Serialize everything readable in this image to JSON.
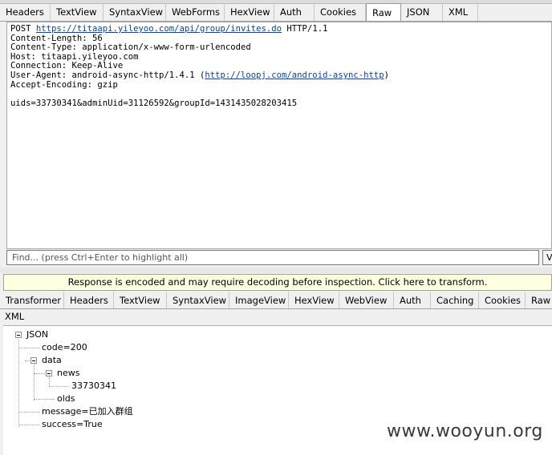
{
  "request_tabs": [
    "Headers",
    "TextView",
    "SyntaxView",
    "WebForms",
    "HexView",
    "Auth",
    "Cookies",
    "Raw",
    "JSON",
    "XML"
  ],
  "request_selected_tab": "Raw",
  "raw": {
    "line1_method": "POST ",
    "line1_url": "https://titaapi.yileyoo.com/api/group/invites.do",
    "line1_proto": " HTTP/1.1",
    "content_length": "Content-Length: 56",
    "content_type": "Content-Type: application/x-www-form-urlencoded",
    "host": "Host: titaapi.yileyoo.com",
    "connection": "Connection: Keep-Alive",
    "ua_prefix": "User-Agent: android-async-http/1.4.1 (",
    "ua_link": "http://loopj.com/android-async-http",
    "ua_suffix": ")",
    "accept_encoding": "Accept-Encoding: gzip",
    "body": "uids=33730341&adminUid=31126592&groupId=1431435028203415"
  },
  "find": {
    "placeholder": "Find... (press Ctrl+Enter to highlight all)",
    "button_label": "V"
  },
  "banner": "Response is encoded and may require decoding before inspection. Click here to transform.",
  "response_tabs_row1": [
    "Transformer",
    "Headers",
    "TextView",
    "SyntaxView",
    "ImageView",
    "HexView",
    "WebView",
    "Auth",
    "Caching",
    "Cookies",
    "Raw"
  ],
  "response_tabs_row2": [
    "XML"
  ],
  "tree": {
    "root": "JSON",
    "code": "code=200",
    "data": "data",
    "news": "news",
    "news_value": "33730341",
    "olds": "olds",
    "message": "message=已加入群组",
    "success": "success=True"
  },
  "watermark": "www.wooyun.org"
}
